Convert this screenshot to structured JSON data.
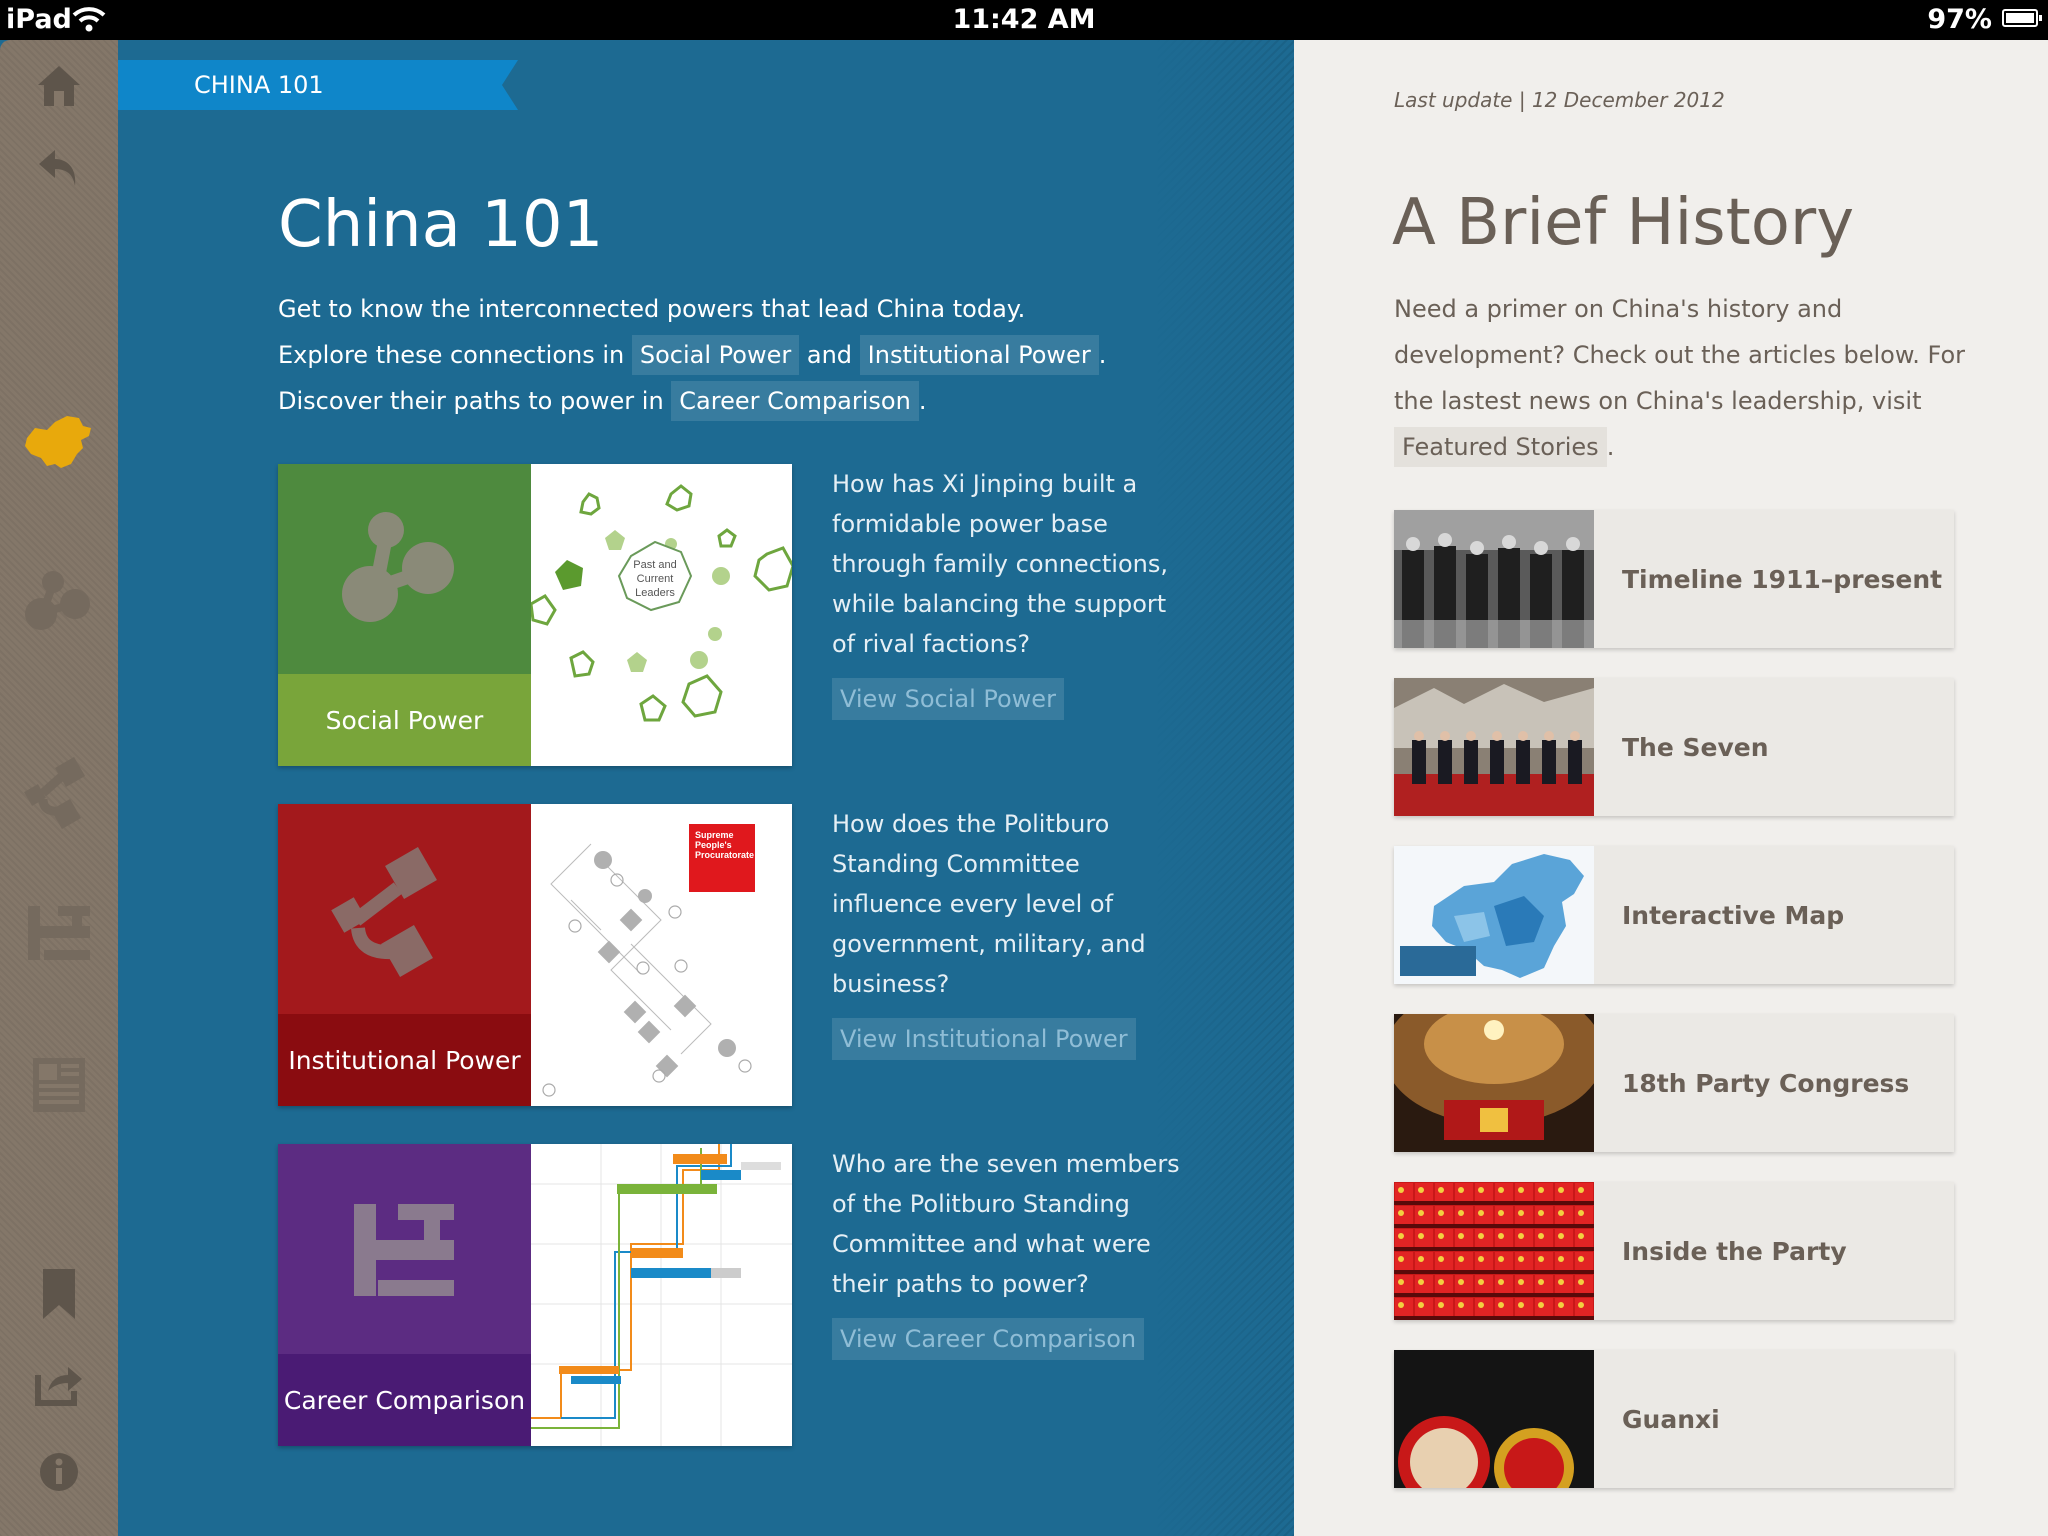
{
  "status_bar": {
    "device": "iPad",
    "time": "11:42 AM",
    "battery": "97%"
  },
  "sidebar": {
    "icons": [
      "home-icon",
      "back-icon",
      "china-map-icon",
      "social-power-icon",
      "institutional-power-icon",
      "career-comparison-icon",
      "news-icon",
      "bookmark-icon",
      "share-icon",
      "info-icon"
    ],
    "active_icon": "china-map-icon",
    "active_color": "#e8a90c"
  },
  "main": {
    "ribbon": "CHINA 101",
    "title": "China 101",
    "intro": {
      "line1": "Get to know the interconnected powers that lead China today.",
      "line2_pre": "Explore these connections in",
      "line2_link1": "Social Power",
      "line2_mid": "and",
      "line2_link2": "Institutional Power",
      "line2_post": ".",
      "line3_pre": "Discover their paths to power in",
      "line3_link": "Career Comparison",
      "line3_post": "."
    },
    "cards": [
      {
        "label": "Social Power",
        "color_top": "#4e8a3e",
        "color_label": "#79a53a",
        "thumb_text": [
          "Past and",
          "Current",
          "Leaders"
        ],
        "question": "How has Xi Jinping built a formidable power base through family connections, while balancing the support of rival factions?",
        "link": "View Social Power"
      },
      {
        "label": "Institutional Power",
        "color_top": "#a3191c",
        "color_label": "#8a0c10",
        "thumb_text": [
          "Supreme",
          "People's",
          "Procuratorate"
        ],
        "question": "How does the Politburo Standing Committee influence every level of government, military, and business?",
        "link": "View Institutional Power"
      },
      {
        "label": "Career Comparison",
        "color_top": "#5c2c82",
        "color_label": "#4a1b74",
        "thumb_text": [],
        "question": "Who are the seven members of the Politburo Standing Committee and what were their paths to power?",
        "link": "View Career Comparison"
      }
    ]
  },
  "right": {
    "last_update": "Last update | 12 December 2012",
    "title": "A Brief History",
    "intro_text": "Need a primer on China's history and development? Check out the articles below. For the lastest news on China's leadership, visit",
    "intro_link": "Featured Stories",
    "intro_post": ".",
    "articles": [
      {
        "label": "Timeline 1911–present",
        "thumb": "black-and-white-soldiers"
      },
      {
        "label": "The Seven",
        "thumb": "leaders-lineup"
      },
      {
        "label": "Interactive Map",
        "thumb": "china-map"
      },
      {
        "label": "18th Party Congress",
        "thumb": "great-hall-ceiling"
      },
      {
        "label": "Inside the Party",
        "thumb": "red-flags-crowd"
      },
      {
        "label": "Guanxi",
        "thumb": "mao-badges"
      }
    ]
  }
}
